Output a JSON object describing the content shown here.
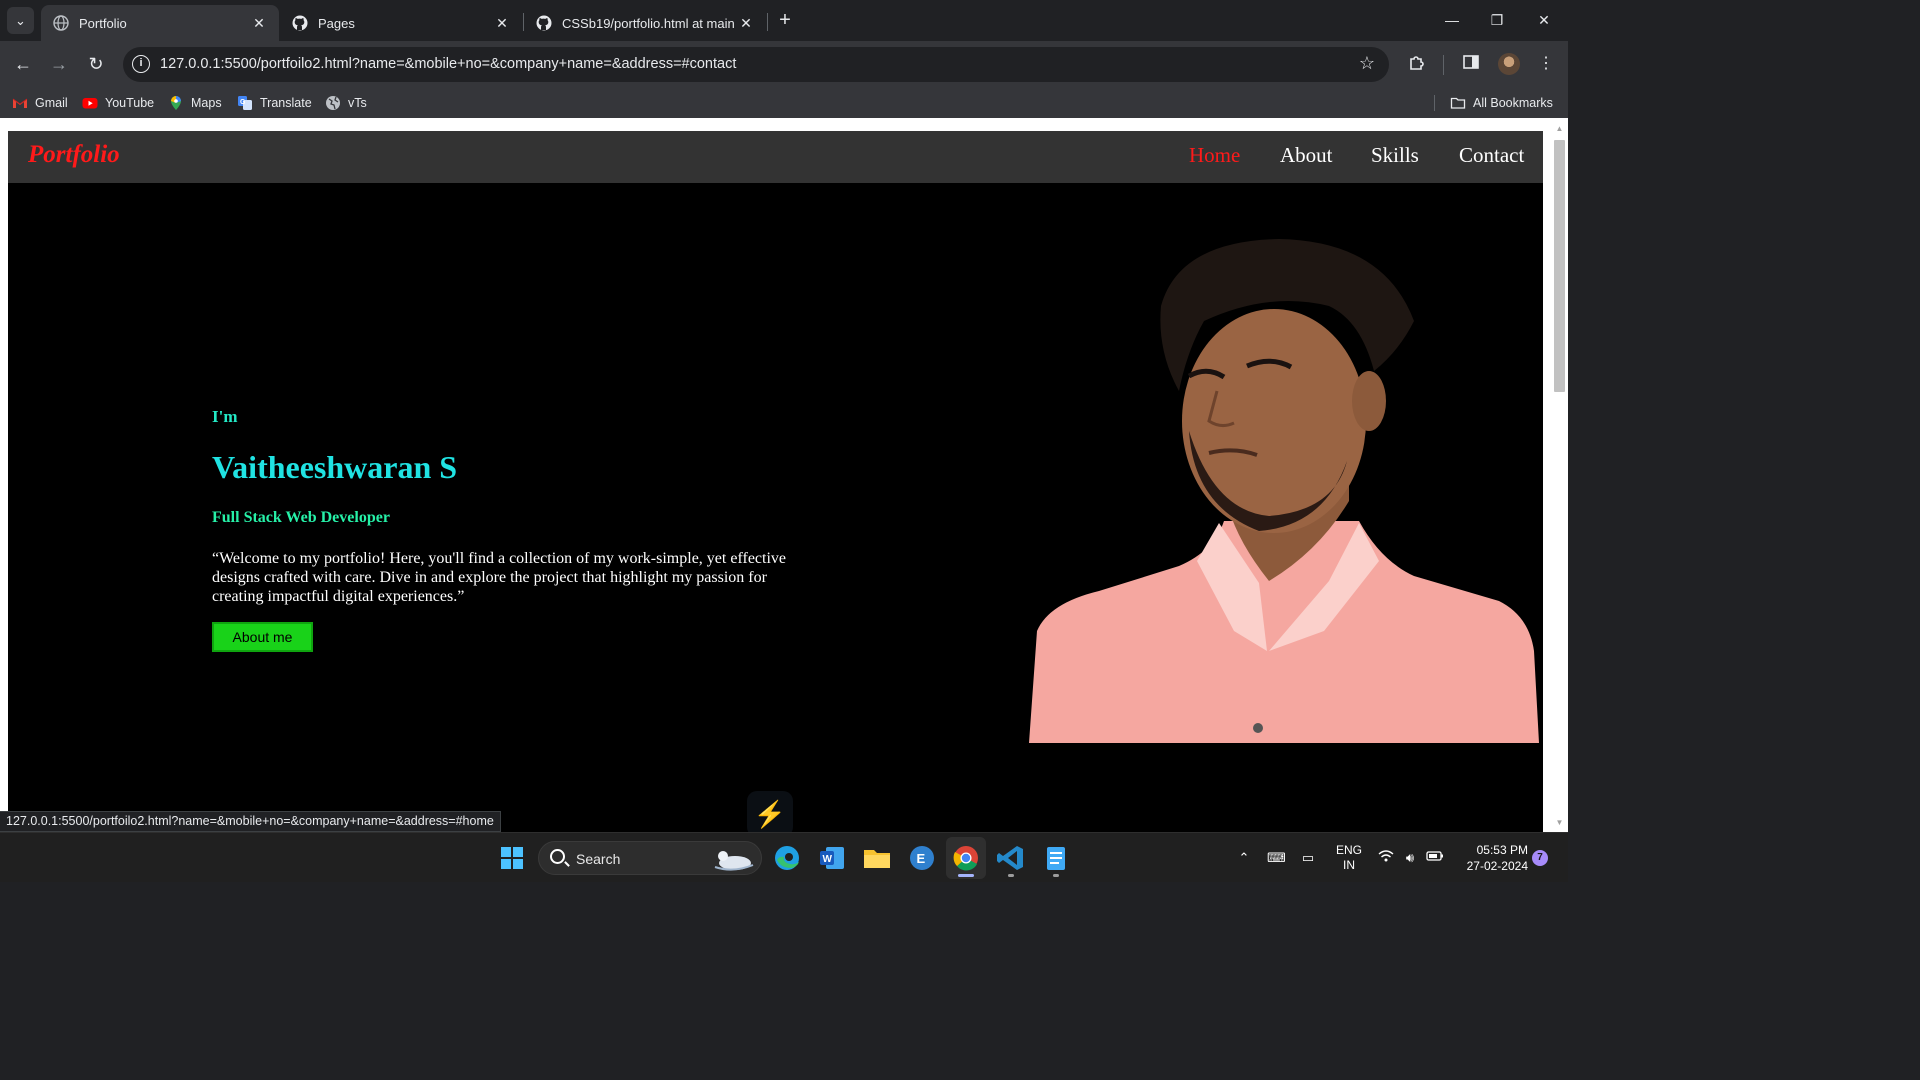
{
  "browser": {
    "tabs": [
      {
        "title": "Portfolio",
        "active": true
      },
      {
        "title": "Pages",
        "active": false
      },
      {
        "title": "CSSb19/portfolio.html at main",
        "active": false
      }
    ],
    "address_bar": {
      "url": "127.0.0.1:5500/portfoilo2.html?name=&mobile+no=&company+name=&address=#contact"
    },
    "bookmarks": [
      {
        "label": "Gmail",
        "icon": "gmail-icon"
      },
      {
        "label": "YouTube",
        "icon": "youtube-icon"
      },
      {
        "label": "Maps",
        "icon": "maps-icon"
      },
      {
        "label": "Translate",
        "icon": "translate-icon"
      },
      {
        "label": "vTs",
        "icon": "globe-icon"
      }
    ],
    "all_bookmarks_label": "All Bookmarks",
    "status_bar_url": "127.0.0.1:5500/portfoilo2.html?name=&mobile+no=&company+name=&address=#home"
  },
  "site": {
    "brand": "Portfolio",
    "nav": [
      {
        "label": "Home",
        "active": true
      },
      {
        "label": "About",
        "active": false
      },
      {
        "label": "Skills",
        "active": false
      },
      {
        "label": "Contact",
        "active": false
      }
    ],
    "hero": {
      "greeting": "I'm",
      "name": "Vaitheeshwaran S",
      "role": "Full Stack Web Developer",
      "intro": "“Welcome to my portfolio! Here, you'll find a collection of my work-simple, yet effective designs crafted with care. Dive in and explore the project that highlight my passion for creating impactful digital experiences.”",
      "button_label": "About me"
    },
    "colors": {
      "accent_red": "#ff1a1a",
      "greeting": "#23e8c5",
      "name": "#20e3e3",
      "role": "#26f1a8",
      "button": "#19d219"
    }
  },
  "taskbar": {
    "search_label": "Search",
    "apps": [
      "start-icon",
      "edge-icon",
      "word-icon",
      "file-explorer-icon",
      "app-icon",
      "chrome-icon",
      "vscode-icon",
      "notepad-icon"
    ],
    "language": {
      "line1": "ENG",
      "line2": "IN"
    },
    "time": "05:53 PM",
    "date": "27-02-2024",
    "notification_count": "7"
  }
}
